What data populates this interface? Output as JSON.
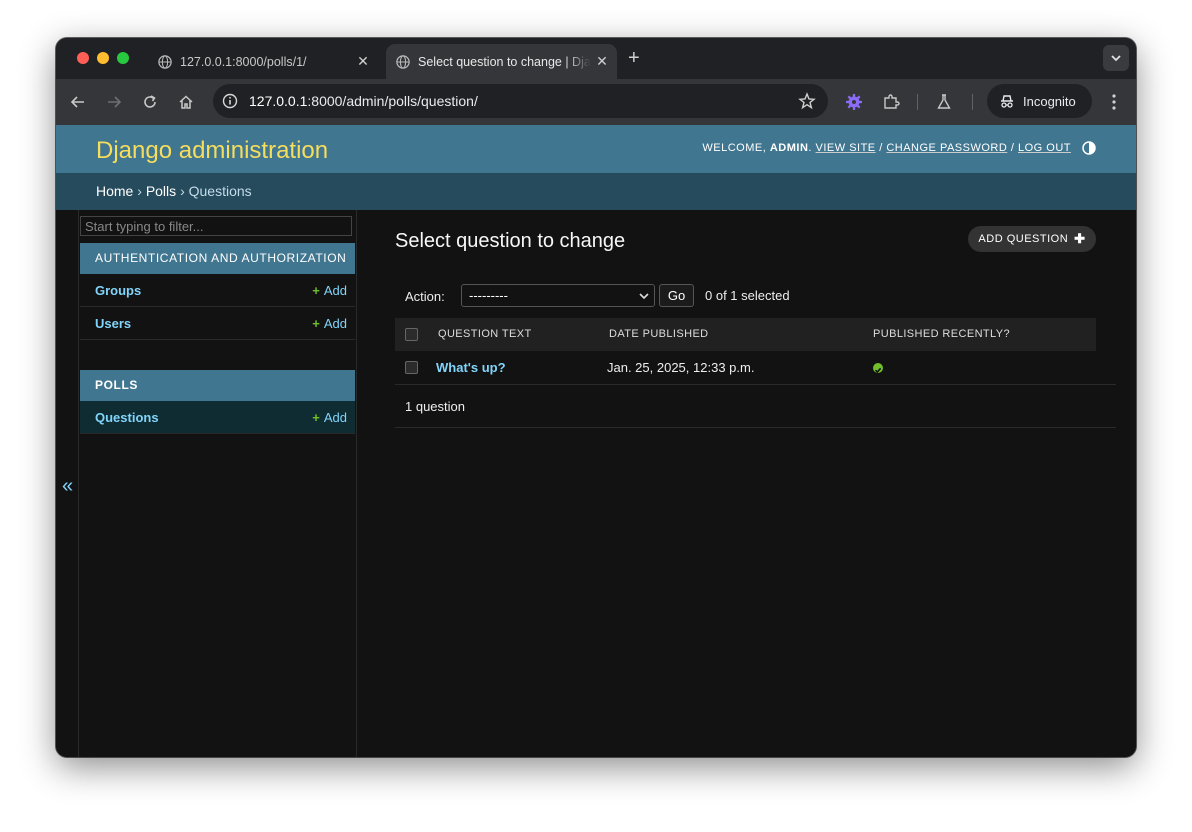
{
  "browser": {
    "tabs": [
      {
        "title": "127.0.0.1:8000/polls/1/",
        "active": false
      },
      {
        "title": "Select question to change | Django site admin",
        "active": true
      }
    ],
    "url_host": "127.0.0.1",
    "url_rest": ":8000/admin/polls/question/",
    "profile_label": "Incognito"
  },
  "header": {
    "branding": "Django administration",
    "welcome": "WELCOME,",
    "username": "ADMIN",
    "view_site": "VIEW SITE",
    "change_password": "CHANGE PASSWORD",
    "log_out": "LOG OUT"
  },
  "breadcrumbs": {
    "home": "Home",
    "app": "Polls",
    "current": "Questions",
    "sep": "›"
  },
  "sidebar": {
    "filter_placeholder": "Start typing to filter...",
    "modules": [
      {
        "caption": "AUTHENTICATION AND AUTHORIZATION",
        "rows": [
          {
            "label": "Groups",
            "add": "Add"
          },
          {
            "label": "Users",
            "add": "Add"
          }
        ]
      },
      {
        "caption": "POLLS",
        "rows": [
          {
            "label": "Questions",
            "add": "Add"
          }
        ]
      }
    ],
    "collapse_glyph": "«"
  },
  "content": {
    "title": "Select question to change",
    "add_button": "ADD QUESTION",
    "action_label": "Action:",
    "action_selected": "---------",
    "go_label": "Go",
    "selection_count": "0 of 1 selected",
    "columns": [
      "QUESTION TEXT",
      "DATE PUBLISHED",
      "PUBLISHED RECENTLY?"
    ],
    "rows": [
      {
        "question_text": "What's up?",
        "date_published": "Jan. 25, 2025, 12:33 p.m.",
        "published_recently": true
      }
    ],
    "paginator": "1 question"
  },
  "colors": {
    "header_bg": "#417690",
    "branding": "#f5dd5d",
    "breadcrumbs_bg": "#264b5d",
    "link": "#81d4fa",
    "add_green": "#70bf2b"
  }
}
